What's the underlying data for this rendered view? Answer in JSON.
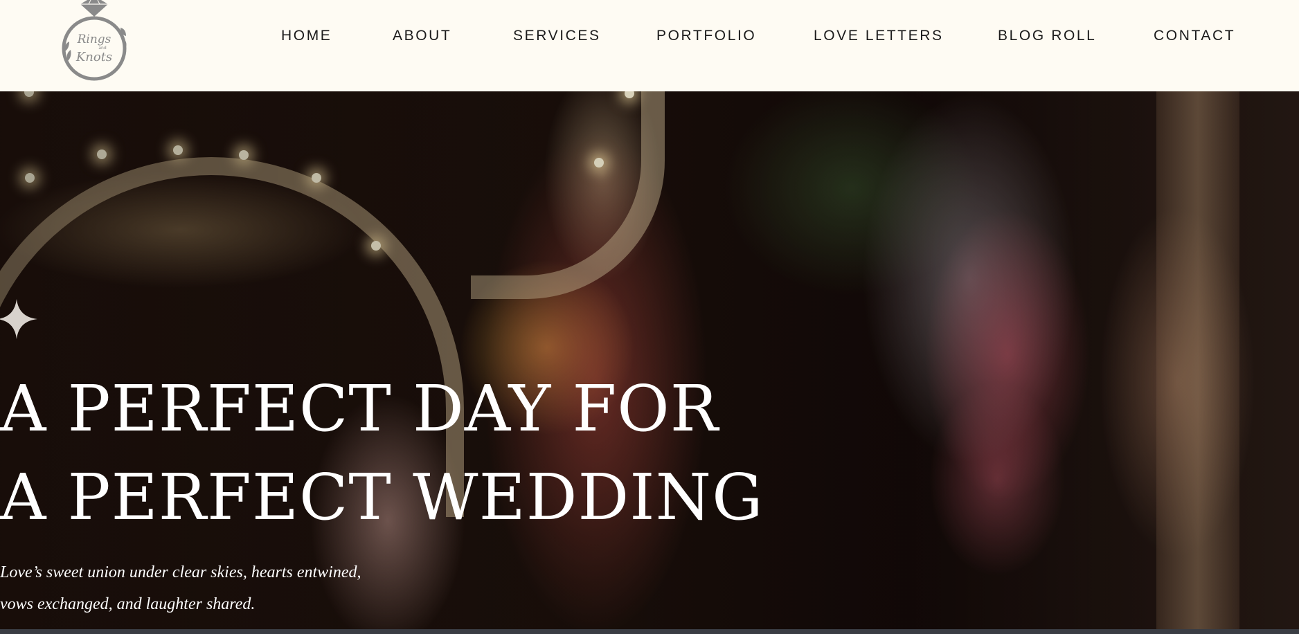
{
  "header": {
    "logo": {
      "text_line1": "Rings",
      "text_line2": "and",
      "text_line3": "Knots"
    },
    "nav": [
      {
        "label": "HOME"
      },
      {
        "label": "ABOUT"
      },
      {
        "label": "SERVICES"
      },
      {
        "label": "PORTFOLIO"
      },
      {
        "label": "LOVE LETTERS"
      },
      {
        "label": "BLOG ROLL"
      },
      {
        "label": "CONTACT"
      }
    ]
  },
  "hero": {
    "title_line1": "A PERFECT DAY FOR",
    "title_line2": "A PERFECT WEDDING",
    "subtitle_line1": "Love’s sweet union under clear skies, hearts entwined,",
    "subtitle_line2": "vows exchanged, and laughter shared.",
    "icon": "sparkle-icon"
  },
  "colors": {
    "header_bg": "#fefbf3",
    "nav_text": "#1b1b1b",
    "logo_gray": "#8a8a8a",
    "hero_text": "#ffffff"
  }
}
